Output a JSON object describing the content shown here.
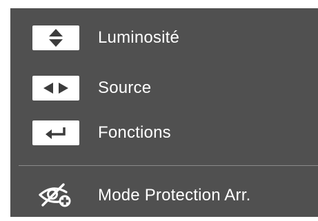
{
  "menu": {
    "items": [
      {
        "label": "Luminosité",
        "icon": "up-down-arrows-icon"
      },
      {
        "label": "Source",
        "icon": "left-right-arrows-icon"
      },
      {
        "label": "Fonctions",
        "icon": "enter-icon"
      }
    ],
    "footer_item": {
      "label": "Mode Protection Arr.",
      "icon": "eye-saver-icon"
    }
  },
  "colors": {
    "panel_background": "#505050",
    "key_background": "#ffffff",
    "icon_color": "#3c3c3c",
    "text_color": "#ffffff",
    "divider": "#8a8a8a"
  }
}
